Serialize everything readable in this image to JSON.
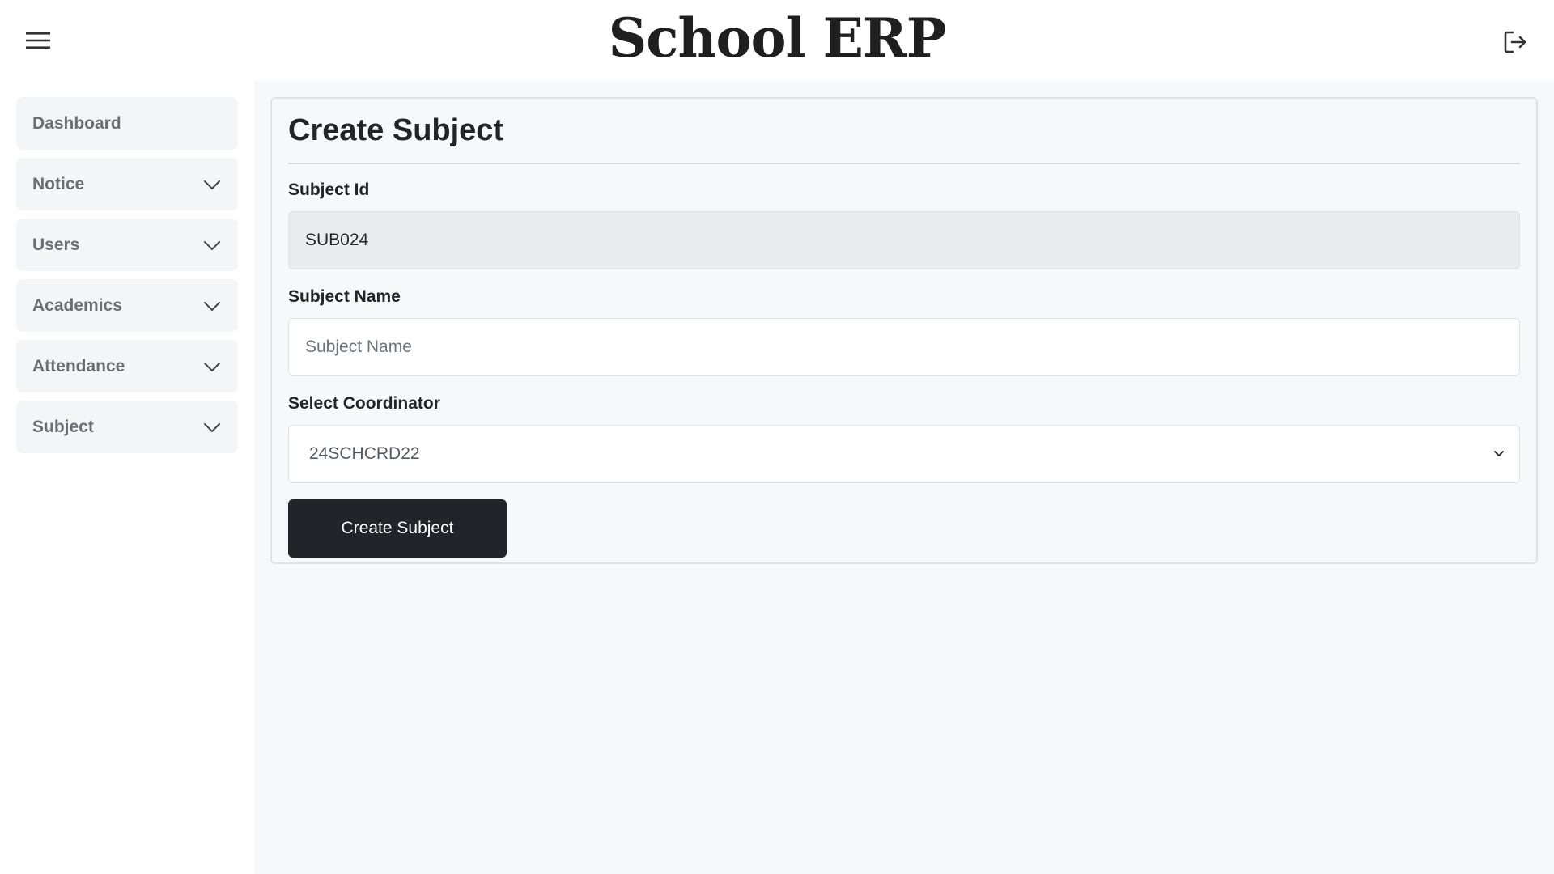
{
  "header": {
    "title": "School ERP",
    "menu_icon": "hamburger-menu-icon",
    "logout_icon": "logout-icon"
  },
  "sidebar": {
    "items": [
      {
        "label": "Dashboard",
        "expandable": false
      },
      {
        "label": "Notice",
        "expandable": true
      },
      {
        "label": "Users",
        "expandable": true
      },
      {
        "label": "Academics",
        "expandable": true
      },
      {
        "label": "Attendance",
        "expandable": true
      },
      {
        "label": "Subject",
        "expandable": true
      }
    ]
  },
  "form": {
    "title": "Create Subject",
    "subject_id": {
      "label": "Subject Id",
      "value": "SUB024"
    },
    "subject_name": {
      "label": "Subject Name",
      "placeholder": "Subject Name",
      "value": ""
    },
    "coordinator": {
      "label": "Select Coordinator",
      "selected": "24SCHCRD22"
    },
    "submit_label": "Create Subject"
  },
  "colors": {
    "button_bg": "#212529",
    "sidebar_item_bg": "#f4f5f6",
    "main_bg": "#f7f8fa"
  }
}
